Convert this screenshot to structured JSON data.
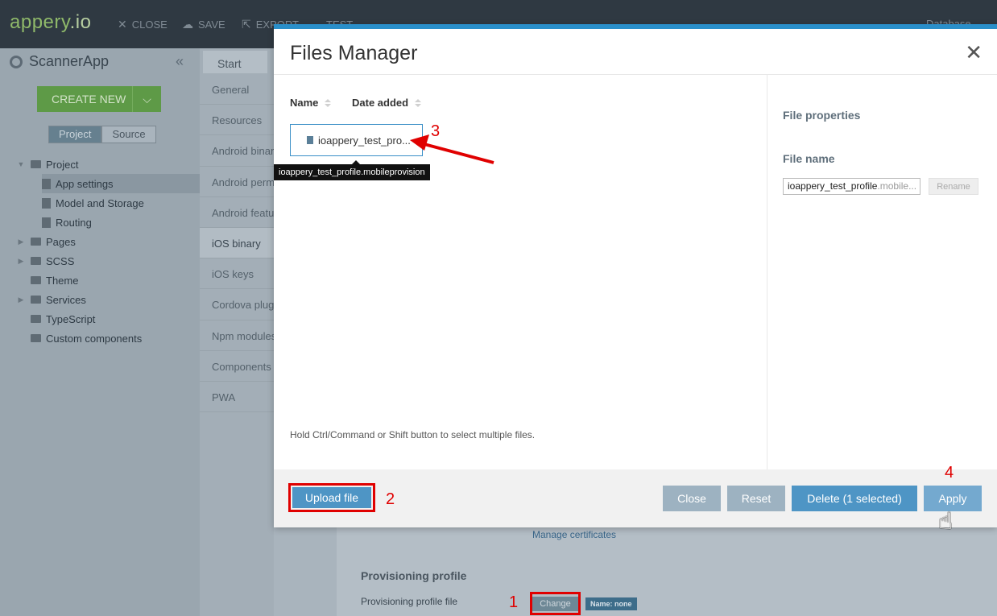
{
  "app": {
    "logo_main": "appery",
    "logo_suffix": ".io",
    "project_name": "ScannerApp",
    "toolbar": [
      {
        "label": "CLOSE",
        "icon": "close-icon"
      },
      {
        "label": "SAVE",
        "icon": "cloud-save-icon"
      },
      {
        "label": "EXPORT",
        "icon": "export-icon"
      },
      {
        "label": "TEST",
        "icon": "chevron-down-icon"
      }
    ],
    "toolbar_right": "Database",
    "create_new_label": "CREATE NEW",
    "view_toggle": {
      "project": "Project",
      "source": "Source"
    },
    "tree": [
      {
        "label": "Project",
        "type": "folder",
        "expanded": true
      },
      {
        "label": "App settings",
        "type": "file",
        "selected": true
      },
      {
        "label": "Model and Storage",
        "type": "file"
      },
      {
        "label": "Routing",
        "type": "file"
      },
      {
        "label": "Pages",
        "type": "folder"
      },
      {
        "label": "SCSS",
        "type": "folder"
      },
      {
        "label": "Theme",
        "type": "folder"
      },
      {
        "label": "Services",
        "type": "folder"
      },
      {
        "label": "TypeScript",
        "type": "folder"
      },
      {
        "label": "Custom components",
        "type": "folder"
      }
    ],
    "start_tab": "Start",
    "settings_nav": [
      "General",
      "Resources",
      "Android binary",
      "Android permissions",
      "Android features",
      "iOS binary",
      "iOS keys",
      "Cordova plugins",
      "Npm modules",
      "Components",
      "PWA"
    ],
    "settings_nav_selected": "iOS binary",
    "manage_certificates": "Manage certificates",
    "provisioning_profile_heading": "Provisioning profile",
    "provisioning_profile_file": "Provisioning profile file",
    "change_button": "Change",
    "name_badge": "Name: none"
  },
  "modal": {
    "title": "Files Manager",
    "columns": {
      "name": "Name",
      "date_added": "Date added"
    },
    "file_tile_label": "ioappery_test_pro...",
    "tooltip": "ioappery_test_profile.mobileprovision",
    "hint": "Hold Ctrl/Command or Shift button to select multiple files.",
    "file_properties_title": "File properties",
    "file_name_label": "File name",
    "file_name_value": "ioappery_test_profile",
    "file_name_ext": ".mobile...",
    "rename_button": "Rename",
    "upload_button": "Upload file",
    "close_button": "Close",
    "reset_button": "Reset",
    "delete_button": "Delete (1 selected)",
    "apply_button": "Apply"
  },
  "annotations": {
    "a1": "1",
    "a2": "2",
    "a3": "3",
    "a4": "4"
  },
  "colors": {
    "accent": "#2a8fc9",
    "primary_button": "#4e95c5",
    "annotation": "#e00000",
    "create_new": "#5e9a47"
  }
}
